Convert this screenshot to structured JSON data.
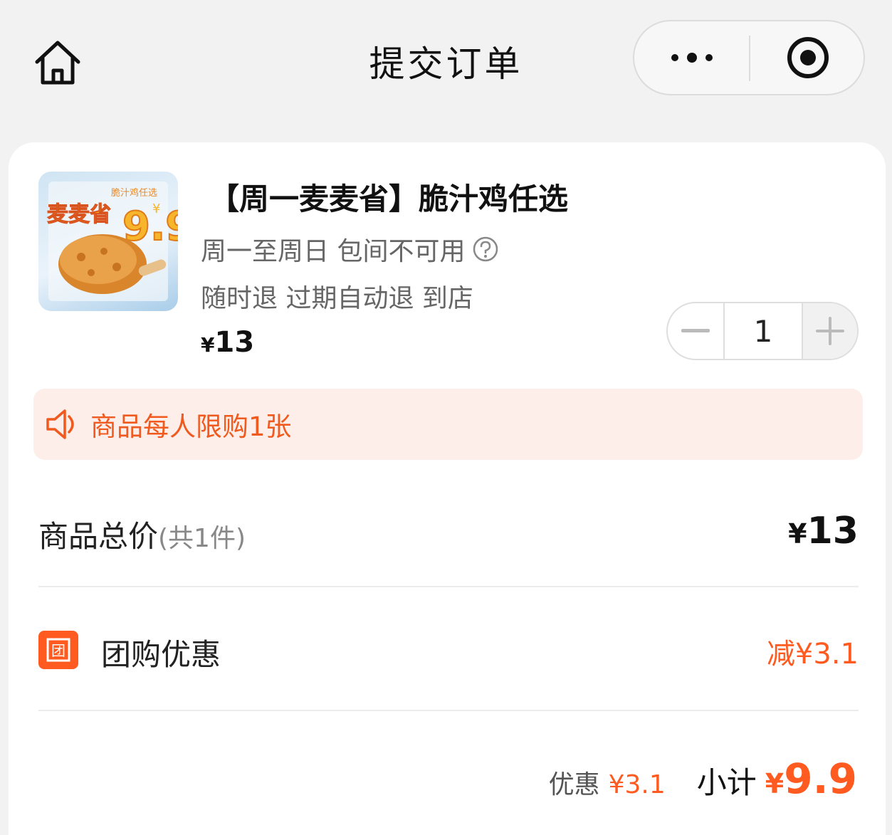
{
  "header": {
    "title": "提交订单",
    "home_icon": "home-icon",
    "more_icon": "more-dots-icon",
    "close_icon": "target-circle-icon"
  },
  "product": {
    "title": "【周一麦麦省】脆汁鸡任选",
    "spec_line1": "周一至周日 包间不可用",
    "spec_line2": "随时退 过期自动退 到店",
    "price_symbol": "¥",
    "price": "13",
    "thumb_badge": "麦麦省",
    "thumb_sub": "脆汁鸡任选",
    "thumb_price": "9.9",
    "thumb_price_symbol": "¥",
    "quantity": "1"
  },
  "notice": {
    "text": "商品每人限购1张"
  },
  "summary": {
    "total_label": "商品总价",
    "total_count": "(共1件)",
    "total_symbol": "¥",
    "total_value": "13",
    "groupbuy_badge": "团",
    "groupbuy_label": "团购优惠",
    "groupbuy_value": "减¥3.1",
    "discount_label": "优惠",
    "discount_value": "¥3.1",
    "subtotal_label": "小计",
    "subtotal_symbol": "¥",
    "subtotal_value": "9.9"
  },
  "colors": {
    "accent": "#ff5a1f",
    "notice_bg": "#fdeeea",
    "page_bg": "#f2f2f2"
  }
}
